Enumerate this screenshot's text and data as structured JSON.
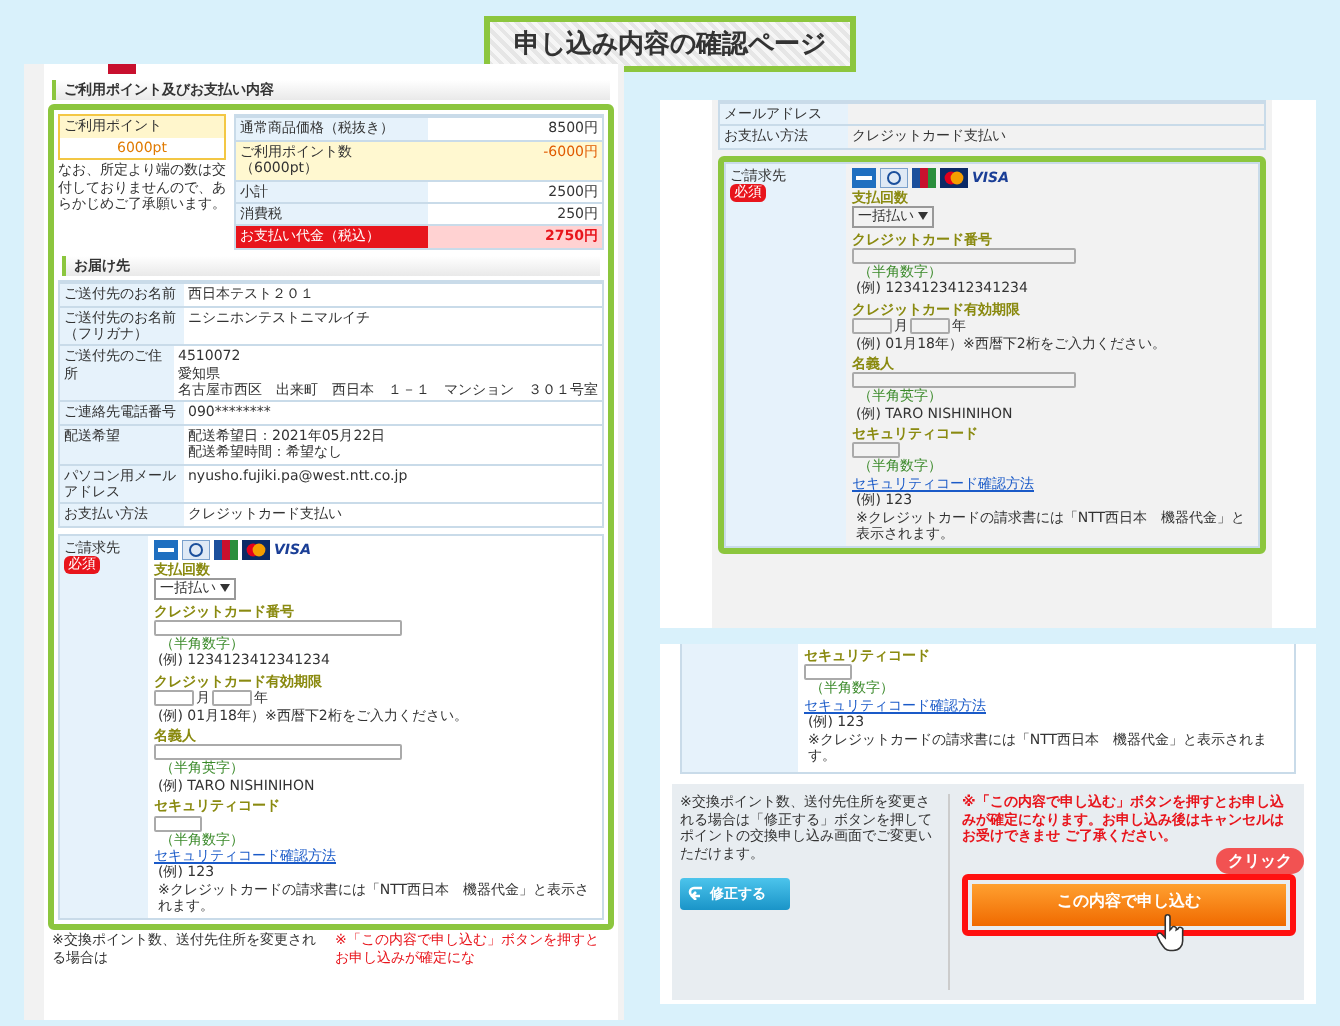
{
  "title": "申し込み内容の確認ページ",
  "screen_1": {
    "points_section": {
      "heading": "ご利用ポイント及びお支払い内容",
      "points_box": {
        "label": "ご利用ポイント",
        "value": "6000pt"
      },
      "note": "なお、所定より端の数は交付しておりませんので、あらかじめご了承願います。",
      "price_rows": [
        {
          "kind": "normal",
          "label": "通常商品価格（税抜き）",
          "value": "8500円"
        },
        {
          "kind": "discount",
          "label": "ご利用ポイント数（6000pt）",
          "value": "-6000円"
        },
        {
          "kind": "normal",
          "label": "小計",
          "value": "2500円"
        },
        {
          "kind": "normal",
          "label": "消費税",
          "value": "250円"
        },
        {
          "kind": "total",
          "label": "お支払い代金（税込）",
          "value": "2750円"
        }
      ]
    },
    "delivery_section": {
      "heading": "お届け先",
      "rows": [
        {
          "label": "ご送付先のお名前",
          "lines": [
            "西日本テスト２０１"
          ]
        },
        {
          "label": "ご送付先のお名前（フリガナ）",
          "lines": [
            "ニシニホンテストニマルイチ"
          ]
        },
        {
          "label": "ご送付先のご住所",
          "lines": [
            "4510072",
            "愛知県",
            "名古屋市西区　出来町　西日本　１－１　マンション　３０１号室"
          ]
        },
        {
          "label": "ご連絡先電話番号",
          "lines": [
            "090********"
          ]
        },
        {
          "label": "配送希望",
          "lines": [
            "配送希望日：2021年05月22日",
            "配送希望時間：希望なし"
          ]
        },
        {
          "label": "パソコン用メールアドレス",
          "lines": [
            "nyusho.fujiki.pa@west.ntt.co.jp"
          ]
        },
        {
          "label": "お支払い方法",
          "lines": [
            "クレジットカード支払い"
          ]
        }
      ]
    },
    "payment": {
      "label": "ご請求先",
      "badge": "必須",
      "visa": "VISA",
      "installments": {
        "label": "支払回数",
        "value": "一括払い"
      },
      "card_number": {
        "label": "クレジットカード番号",
        "hint": "（半角数字）",
        "example": "(例) 1234123412341234"
      },
      "expiry": {
        "label": "クレジットカード有効期限",
        "month_unit": "月",
        "year_unit": "年",
        "example": "(例) 01月18年）※西暦下2桁をご入力ください。"
      },
      "holder": {
        "label": "名義人",
        "hint": "（半角英字）",
        "example": "(例) TARO NISHINIHON"
      },
      "security": {
        "label": "セキュリティコード",
        "hint": "（半角数字）",
        "link": "セキュリティコード確認方法",
        "example": "(例) 123"
      },
      "note": "※クレジットカードの請求書には「NTT西日本　機器代金」と表示されます。"
    },
    "footer_notes": [
      "※交換ポイント数、送付先住所を変更される場合は",
      "※「この内容で申し込む」ボタンを押すとお申し込みが確定にな"
    ]
  },
  "screen_2": {
    "rows": [
      {
        "label": "メールアドレス",
        "lines": []
      },
      {
        "label": "お支払い方法",
        "lines": [
          "クレジットカード支払い"
        ]
      }
    ],
    "payment": {
      "label": "ご請求先",
      "badge": "必須",
      "visa": "VISA",
      "installments": {
        "label": "支払回数",
        "value": "一括払い"
      },
      "card_number": {
        "label": "クレジットカード番号",
        "hint": "（半角数字）",
        "example": "(例) 1234123412341234"
      },
      "expiry": {
        "label": "クレジットカード有効期限",
        "month_unit": "月",
        "year_unit": "年",
        "example": "(例) 01月18年）※西暦下2桁をご入力ください。"
      },
      "holder": {
        "label": "名義人",
        "hint": "（半角英字）",
        "example": "(例) TARO NISHINIHON"
      },
      "security": {
        "label": "セキュリティコード",
        "hint": "（半角数字）",
        "link": "セキュリティコード確認方法",
        "example": "(例) 123"
      },
      "note": "※クレジットカードの請求書には「NTT西日本　機器代金」と表示されます。"
    }
  },
  "screen_3": {
    "security": {
      "label": "セキュリティコード",
      "hint": "（半角数字）",
      "link": "セキュリティコード確認方法",
      "example": "(例) 123"
    },
    "note": "※クレジットカードの請求書には「NTT西日本　機器代金」と表示されます。",
    "notice": "※交換ポイント数、送付先住所を変更される場合は「修正する」ボタンを押してポイントの交換申し込み画面でご変更いただけます。",
    "warning": "※「この内容で申し込む」ボタンを押すとお申し込みが確定になります。お申し込み後はキャンセルはお受けできませ ご了承ください。",
    "edit_button": "修正する",
    "submit_button": "この内容で申し込む",
    "callout": "クリック"
  }
}
